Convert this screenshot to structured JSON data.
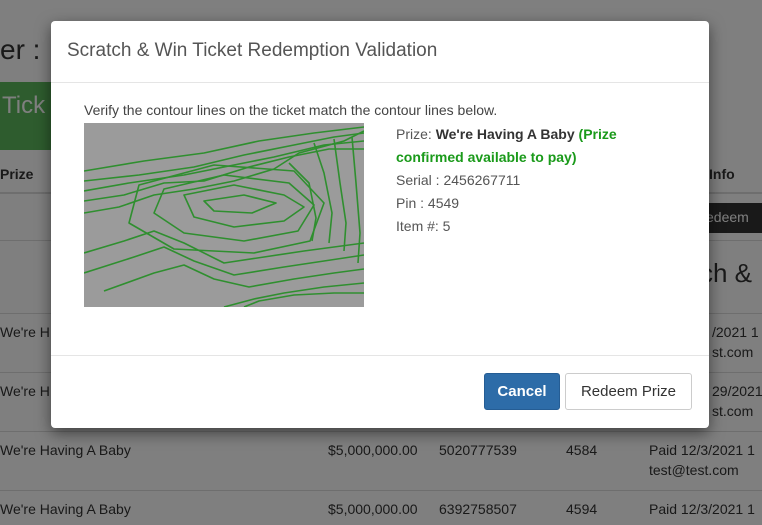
{
  "background": {
    "heading": "er :",
    "tab_label": "Tick",
    "columns": {
      "prize": "Prize",
      "info": "Info"
    },
    "redeem_button": "edeem",
    "section_title": "ch &",
    "rows": [
      {
        "prize": "We're H",
        "info_line1": "/2021 1",
        "info_line2": "st.com"
      },
      {
        "prize": "We're H",
        "info_line1": "29/2021",
        "info_line2": "st.com"
      },
      {
        "prize": "We're Having A Baby",
        "amount": "$5,000,000.00",
        "serial": "5020777539",
        "pin": "4584",
        "info_line1": "Paid 12/3/2021 1",
        "info_line2": "test@test.com"
      },
      {
        "prize": "We're Having A Baby",
        "amount": "$5,000,000.00",
        "serial": "6392758507",
        "pin": "4594",
        "info_line1": "Paid 12/3/2021 1",
        "info_line2": ""
      }
    ]
  },
  "modal": {
    "title": "Scratch & Win Ticket Redemption Validation",
    "instruction": "Verify the contour lines on the ticket match the contour lines below.",
    "prize_label": "Prize:",
    "prize_name": "We're Having A Baby",
    "prize_status": "(Prize confirmed available to pay)",
    "serial": "Serial : 2456267711",
    "pin": "Pin : 4549",
    "item": "Item #: 5",
    "cancel_button": "Cancel",
    "redeem_button": "Redeem Prize"
  },
  "colors": {
    "primary": "#2d6ca8",
    "success": "#1a9a1a",
    "contour": "#2f8f2f",
    "accent_green": "#5cb85c"
  }
}
